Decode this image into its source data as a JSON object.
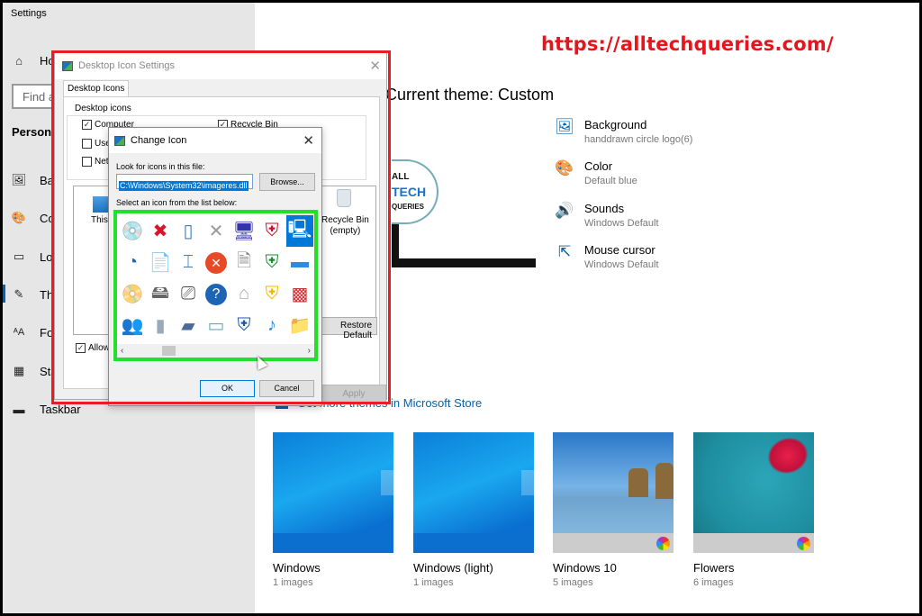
{
  "settings": {
    "app_title": "Settings",
    "find_placeholder": "Find a setting",
    "section_header": "Personalization",
    "nav": [
      {
        "label": "Home",
        "icon": "home-icon"
      },
      {
        "label": "Background",
        "icon": "image-icon"
      },
      {
        "label": "Colors",
        "icon": "palette-icon"
      },
      {
        "label": "Lock screen",
        "icon": "lock-screen-icon"
      },
      {
        "label": "Themes",
        "icon": "themes-icon",
        "active": true
      },
      {
        "label": "Fonts",
        "icon": "fonts-icon"
      },
      {
        "label": "Start",
        "icon": "start-icon"
      },
      {
        "label": "Taskbar",
        "icon": "taskbar-icon"
      }
    ]
  },
  "themes_page": {
    "current_theme_label": "Current theme: Custom",
    "preview_logo": {
      "line1": "ALL",
      "line2": "TECH",
      "line3": "QUERIES"
    },
    "properties": [
      {
        "title": "Background",
        "value": "handdrawn circle logo(6)",
        "icon": "image-icon"
      },
      {
        "title": "Color",
        "value": "Default blue",
        "icon": "palette-icon"
      },
      {
        "title": "Sounds",
        "value": "Windows Default",
        "icon": "speaker-icon"
      },
      {
        "title": "Mouse cursor",
        "value": "Windows Default",
        "icon": "cursor-icon"
      }
    ],
    "store_link": "Get more themes in Microsoft Store",
    "themes": [
      {
        "name": "Windows",
        "count": "1 images"
      },
      {
        "name": "Windows (light)",
        "count": "1 images"
      },
      {
        "name": "Windows 10",
        "count": "5 images"
      },
      {
        "name": "Flowers",
        "count": "6 images"
      }
    ]
  },
  "watermark_url": "https://alltechqueries.com/",
  "desktop_icon_settings": {
    "title": "Desktop Icon Settings",
    "tab": "Desktop Icons",
    "group_label": "Desktop icons",
    "checkboxes": [
      {
        "label": "Computer",
        "checked": true
      },
      {
        "label": "User's Files",
        "checked": false
      },
      {
        "label": "Network",
        "checked": false
      },
      {
        "label": "Recycle Bin",
        "checked": true
      }
    ],
    "icons": [
      {
        "label": "This PC"
      },
      {
        "label": "Recycle Bin\n(empty)"
      }
    ],
    "restore_default": "Restore Default",
    "allow_themes": "Allow themes to change desktop icons",
    "allow_checked": true,
    "apply": "Apply"
  },
  "change_icon": {
    "title": "Change Icon",
    "look_label": "Look for icons in this file:",
    "path_value": "C:\\Windows\\System32\\imageres.dll",
    "browse": "Browse...",
    "select_label": "Select an icon from the list below:",
    "selected_index": 6,
    "icons": [
      "music-cd-icon",
      "red-x-icon",
      "tablet-icon",
      "small-x-icon",
      "monitor-icon",
      "shield-error-icon",
      "computer-icon",
      "clock-sync-icon",
      "document-image-icon",
      "textbox-icon",
      "error-circle-icon",
      "blank-document-icon",
      "shield-check-icon",
      "blue-screen-icon",
      "media-player-icon",
      "drive-icon",
      "scanner-icon",
      "help-circle-icon",
      "projector-icon",
      "shield-warning-icon",
      "programs-icon",
      "users-icon",
      "panel-icon",
      "folder-dark-icon",
      "window-frame-icon",
      "shield-help-icon",
      "music-folder-icon",
      "document-folder-icon"
    ],
    "ok": "OK",
    "cancel": "Cancel"
  }
}
